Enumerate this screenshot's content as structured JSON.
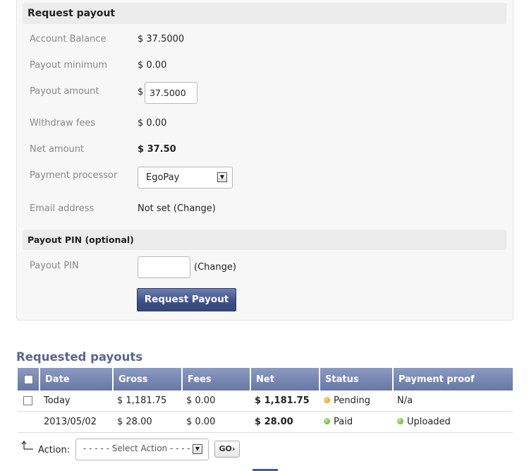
{
  "payout": {
    "title": "Request payout",
    "rows": [
      {
        "label": "Account Balance",
        "value": "$ 37.5000"
      },
      {
        "label": "Payout minimum",
        "value": "$ 0.00"
      },
      {
        "label": "Payout amount",
        "currency": "$",
        "input_value": "37.5000"
      },
      {
        "label": "Withdraw fees",
        "value": "$ 0.00"
      },
      {
        "label": "Net amount",
        "value": "$ 37.50"
      },
      {
        "label": "Payment processor",
        "selected": "EgoPay"
      },
      {
        "label": "Email address",
        "value": "Not set",
        "open_paren": "(",
        "change": "Change",
        "close_paren": ")"
      }
    ]
  },
  "pin": {
    "title": "Payout PIN (optional)",
    "label": "Payout PIN",
    "open_paren": "(",
    "change": "Change",
    "close_paren": ")"
  },
  "button": {
    "label": "Request Payout"
  },
  "requested": {
    "title": "Requested payouts",
    "columns": [
      "Date",
      "Gross",
      "Fees",
      "Net",
      "Status",
      "Payment proof"
    ],
    "rows": [
      {
        "date": "Today",
        "gross": "$ 1,181.75",
        "fees": "$ 0.00",
        "net": "$ 1,181.75",
        "status": "Pending",
        "proof": "N/a",
        "status_color": "#f0a030"
      },
      {
        "date": "2013/05/02",
        "gross": "$ 28.00",
        "fees": "$ 0.00",
        "net": "$ 28.00",
        "status": "Paid",
        "proof": "Uploaded",
        "status_color": "#6cbf3a"
      }
    ]
  },
  "action": {
    "label": "Action:",
    "select": "- - - - - Select Action - - - - -",
    "go": "GO›"
  }
}
